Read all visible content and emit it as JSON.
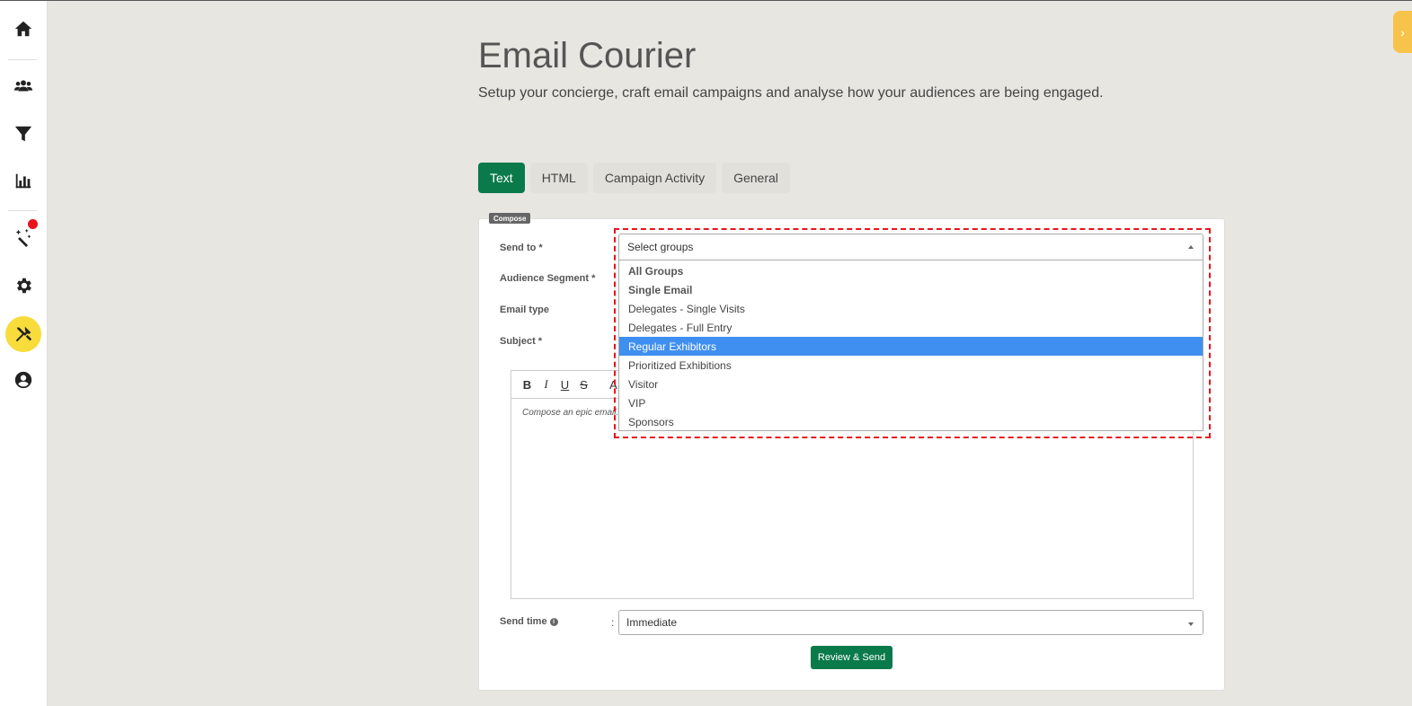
{
  "header": {
    "title": "Email Courier",
    "subtitle": "Setup your concierge, craft email campaigns and analyse how your audiences are being engaged."
  },
  "sidebar": {
    "items": [
      {
        "icon": "home-icon"
      },
      {
        "icon": "users-icon"
      },
      {
        "icon": "filter-icon"
      },
      {
        "icon": "bar-chart-icon"
      },
      {
        "icon": "magic-wand-icon"
      },
      {
        "icon": "gear-icon"
      },
      {
        "icon": "tools-icon"
      },
      {
        "icon": "user-circle-icon"
      }
    ]
  },
  "tabs": [
    {
      "label": "Text"
    },
    {
      "label": "HTML"
    },
    {
      "label": "Campaign Activity"
    },
    {
      "label": "General"
    }
  ],
  "compose": {
    "badge": "Compose",
    "labels": {
      "send_to": "Send to *",
      "audience_segment": "Audience Segment *",
      "email_type": "Email type",
      "subject": "Subject *",
      "send_time": "Send time"
    },
    "colon": ":",
    "send_to_placeholder": "Select groups",
    "group_options": [
      {
        "label": "All Groups",
        "bold": true
      },
      {
        "label": "Single Email",
        "bold": true
      },
      {
        "label": "Delegates - Single Visits"
      },
      {
        "label": "Delegates - Full Entry"
      },
      {
        "label": "Regular Exhibitors",
        "selected": true
      },
      {
        "label": "Prioritized Exhibitions"
      },
      {
        "label": "Visitor"
      },
      {
        "label": "VIP"
      },
      {
        "label": "Sponsors"
      }
    ],
    "editor": {
      "toolbar": [
        "B",
        "I",
        "U",
        "S",
        "A"
      ],
      "placeholder": "Compose an epic email..."
    },
    "send_time_value": "Immediate",
    "review_button": "Review & Send"
  },
  "colors": {
    "accent_green": "#0a7a4a",
    "selected_blue": "#3f8ff0",
    "active_sidebar": "#f7dc3c",
    "highlight_red": "#e8131b"
  }
}
